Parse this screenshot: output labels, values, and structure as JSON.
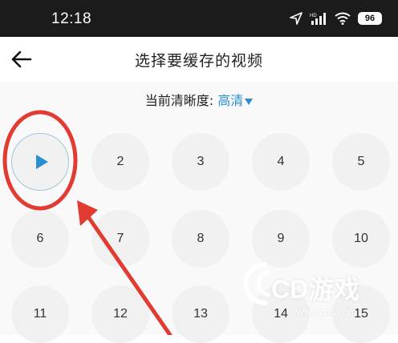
{
  "status_bar": {
    "time": "12:18",
    "battery": "96",
    "icons": [
      "location-icon",
      "signal-icon",
      "wifi-icon",
      "battery-icon"
    ]
  },
  "header": {
    "title": "选择要缓存的视频",
    "back_icon": "back-arrow-icon"
  },
  "quality": {
    "label": "当前清晰度:",
    "value": "高清",
    "accent": "#2a8fd0"
  },
  "episodes": [
    {
      "label": "",
      "state": "playing"
    },
    {
      "label": "2"
    },
    {
      "label": "3"
    },
    {
      "label": "4"
    },
    {
      "label": "5"
    },
    {
      "label": "6"
    },
    {
      "label": "7"
    },
    {
      "label": "8"
    },
    {
      "label": "9"
    },
    {
      "label": "10"
    },
    {
      "label": "11"
    },
    {
      "label": "12"
    },
    {
      "label": "13"
    },
    {
      "label": "14"
    },
    {
      "label": "15"
    }
  ],
  "annotation_color": "#e23b32",
  "watermark": {
    "text": "CD游戏",
    "url": "www.cd6.com"
  }
}
